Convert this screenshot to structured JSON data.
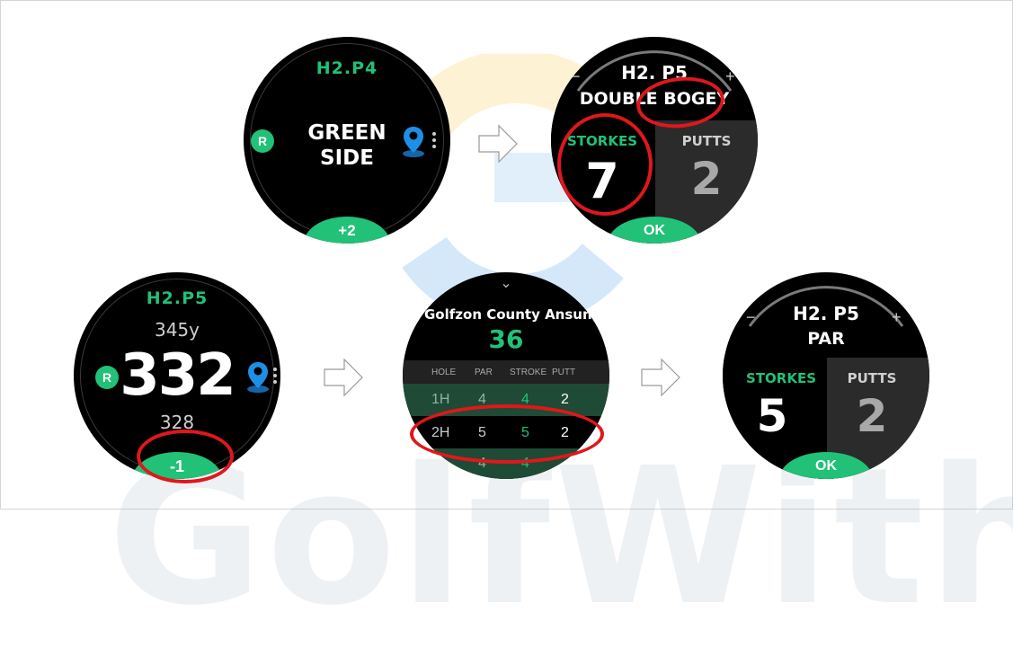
{
  "watch1": {
    "hole": "H2.P4",
    "line1": "GREEN",
    "line2": "SIDE",
    "r_badge": "R",
    "score": "+2"
  },
  "watch2": {
    "minus": "−",
    "plus": "+",
    "hole": "H2. P5",
    "result": "DOUBLE BOGEY",
    "strokes_label": "STORKES",
    "strokes": "7",
    "putts_label": "PUTTS",
    "putts": "2",
    "ok": "OK"
  },
  "watch3": {
    "hole": "H2.P5",
    "back": "345y",
    "middle": "332",
    "front": "328",
    "r_badge": "R",
    "score": "-1"
  },
  "watch4": {
    "chevron": "⌄",
    "course": "Golfzon County AnsungC",
    "total": "36",
    "headers": [
      "HOLE",
      "PAR",
      "STROKE",
      "PUTT"
    ],
    "rows": [
      {
        "hole": "1H",
        "par": "4",
        "stroke": "4",
        "putt": "2"
      },
      {
        "hole": "2H",
        "par": "5",
        "stroke": "5",
        "putt": "2"
      },
      {
        "hole": "",
        "par": "4",
        "stroke": "4",
        "putt": ""
      }
    ]
  },
  "watch5": {
    "minus": "−",
    "plus": "+",
    "hole": "H2. P5",
    "result": "PAR",
    "strokes_label": "STORKES",
    "strokes": "5",
    "putts_label": "PUTTS",
    "putts": "2",
    "ok": "OK"
  },
  "watermark": {
    "text": "GolfWith"
  },
  "colors": {
    "accent": "#21c177",
    "highlight": "#e0171b",
    "pin": "#1e8fe6"
  }
}
